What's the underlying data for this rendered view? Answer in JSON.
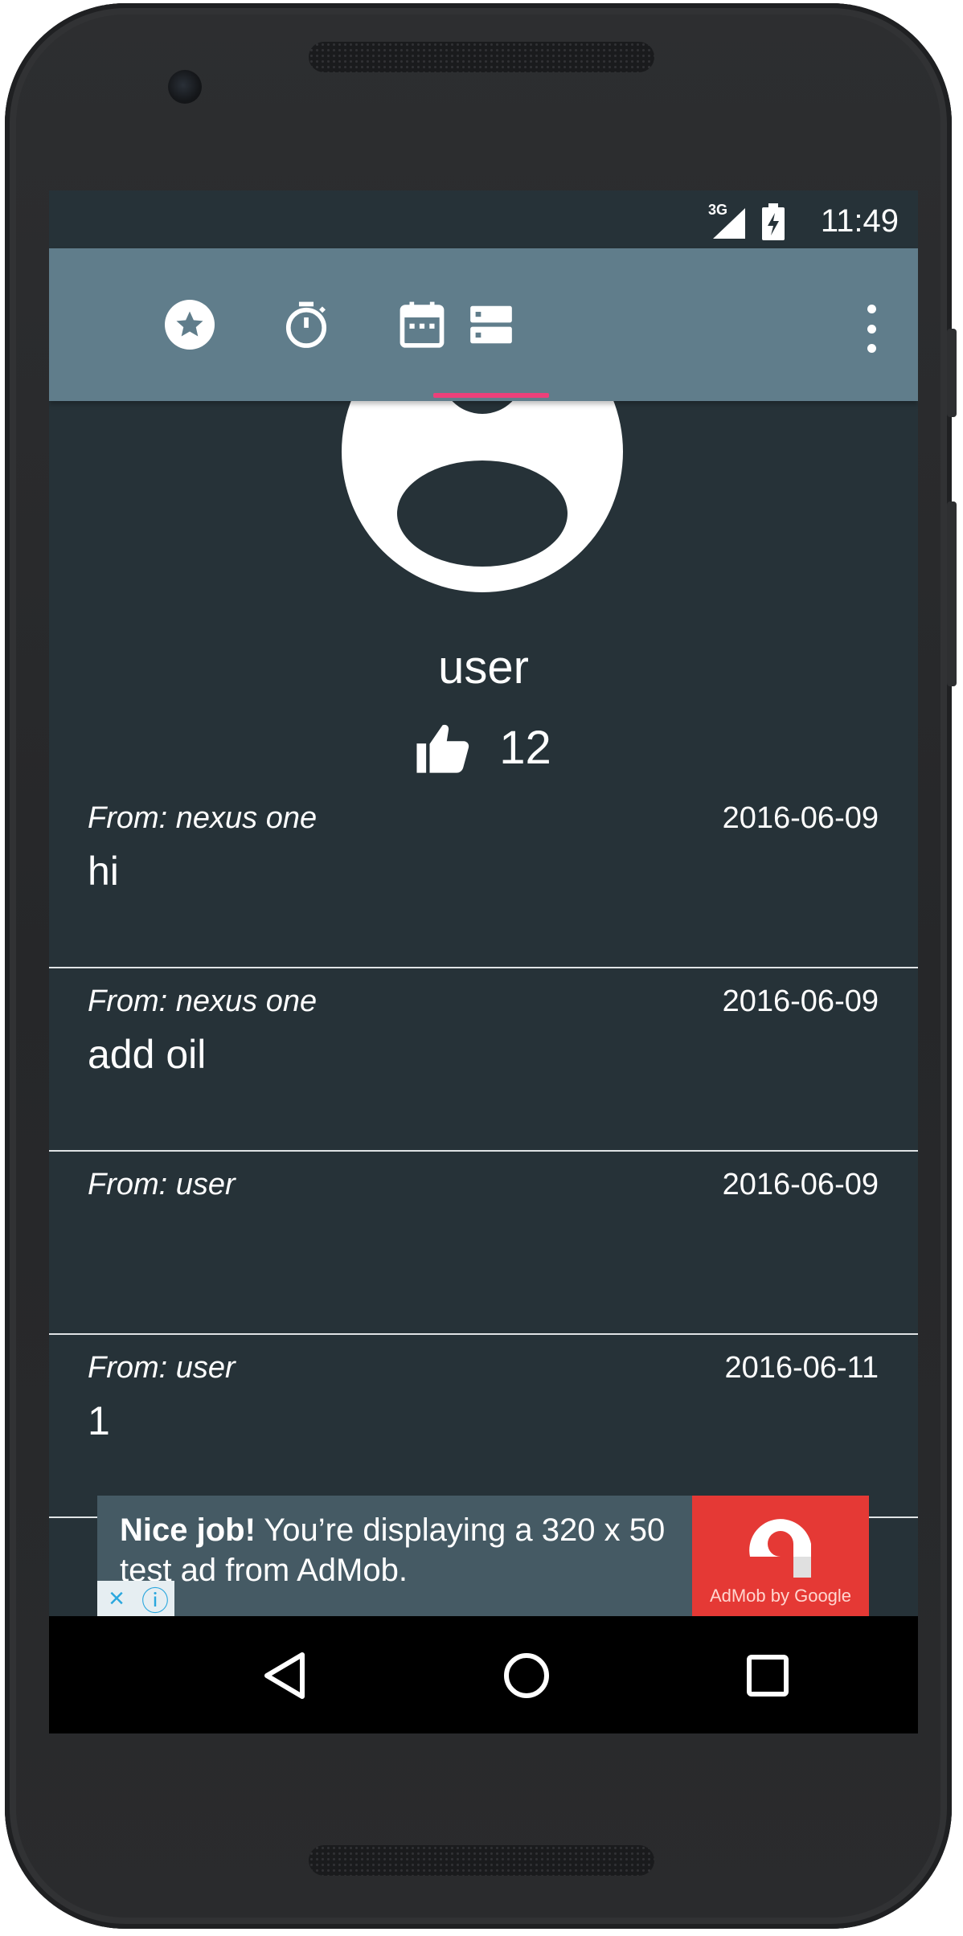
{
  "status_bar": {
    "network": "3G",
    "time": "11:49"
  },
  "toolbar": {
    "tabs": [
      {
        "icon": "star-icon"
      },
      {
        "icon": "timer-icon"
      },
      {
        "icon": "calendar-icon"
      },
      {
        "icon": "storage-icon",
        "selected": true
      }
    ],
    "menu_icon": "more-vert-icon",
    "accent": "#ec407a",
    "background": "#607d8b"
  },
  "profile": {
    "username": "user",
    "likes": "12"
  },
  "messages": [
    {
      "from": "From: nexus one",
      "date": "2016-06-09",
      "body": "hi"
    },
    {
      "from": "From: nexus one",
      "date": "2016-06-09",
      "body": "add oil"
    },
    {
      "from": "From: user",
      "date": "2016-06-09",
      "body": ""
    },
    {
      "from": "From: user",
      "date": "2016-06-11",
      "body": "1"
    }
  ],
  "ad": {
    "headline": "Nice job!",
    "text": " You’re displaying a 320 x 50 test ad from AdMob.",
    "logo_caption": "AdMob by Google",
    "choices": [
      "×",
      "ⓘ"
    ]
  },
  "nav": {
    "back": "back-icon",
    "home": "home-icon",
    "recents": "recents-icon"
  },
  "colors": {
    "screen_bg": "#263238",
    "ad_bg": "#455a64",
    "ad_logo": "#e53935"
  }
}
